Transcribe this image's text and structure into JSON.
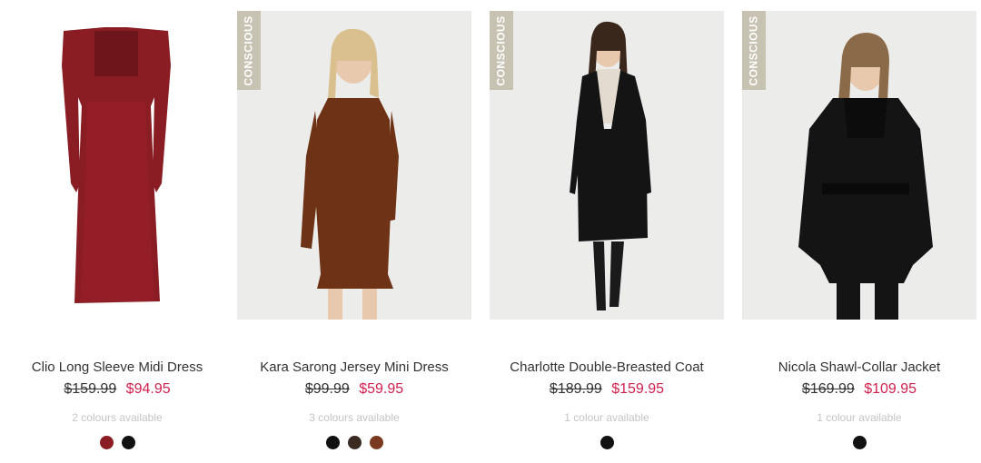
{
  "products": [
    {
      "name": "Clio Long Sleeve Midi Dress",
      "was_price": "$159.99",
      "now_price": "$94.95",
      "colours_text": "2 colours available",
      "swatches": [
        "#8a1c24",
        "#111111"
      ],
      "badge": ""
    },
    {
      "name": "Kara Sarong Jersey Mini Dress",
      "was_price": "$99.99",
      "now_price": "$59.95",
      "colours_text": "3 colours available",
      "swatches": [
        "#111111",
        "#3a2a22",
        "#7a3a22"
      ],
      "badge": "CONSCIOUS"
    },
    {
      "name": "Charlotte Double-Breasted Coat",
      "was_price": "$189.99",
      "now_price": "$159.95",
      "colours_text": "1 colour available",
      "swatches": [
        "#111111"
      ],
      "badge": "CONSCIOUS"
    },
    {
      "name": "Nicola Shawl-Collar Jacket",
      "was_price": "$169.99",
      "now_price": "$109.95",
      "colours_text": "1 colour available",
      "swatches": [
        "#111111"
      ],
      "badge": "CONSCIOUS"
    }
  ],
  "colors": {
    "sale_price": "#d0214e",
    "badge_bg": "#c8c2b2",
    "muted_text": "#c4c4c4"
  }
}
